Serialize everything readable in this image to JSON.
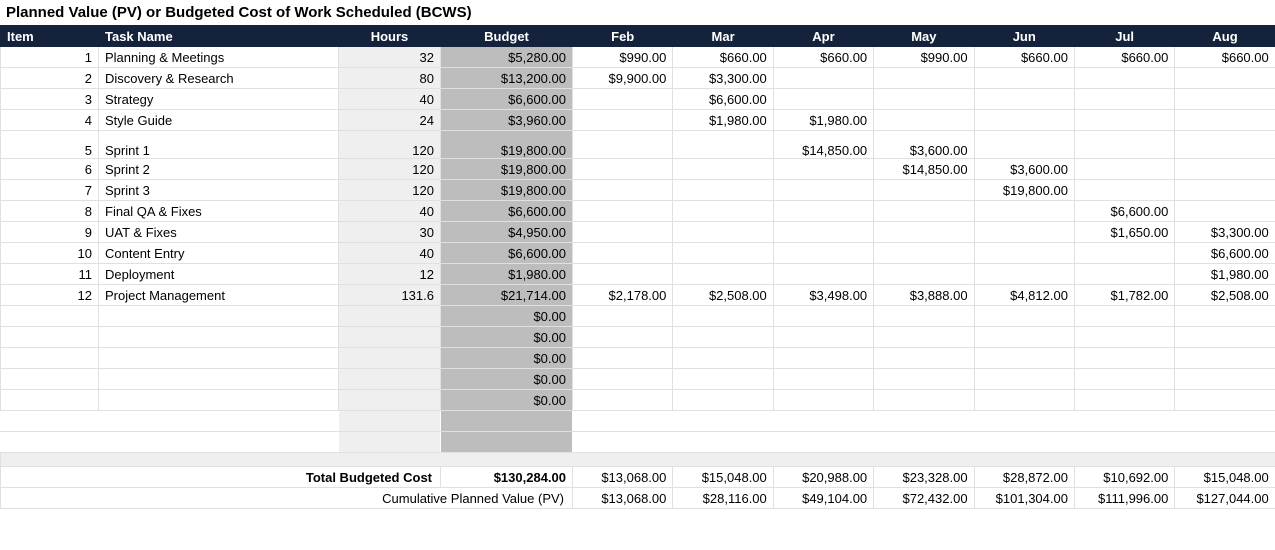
{
  "title": "Planned Value (PV) or Budgeted Cost of Work Scheduled (BCWS)",
  "headers": {
    "item": "Item",
    "task": "Task Name",
    "hours": "Hours",
    "budget": "Budget",
    "months": [
      "Feb",
      "Mar",
      "Apr",
      "May",
      "Jun",
      "Jul",
      "Aug"
    ]
  },
  "rows": [
    {
      "item": "1",
      "task": "Planning & Meetings",
      "hours": "32",
      "budget": "$5,280.00",
      "m": [
        "$990.00",
        "$660.00",
        "$660.00",
        "$990.00",
        "$660.00",
        "$660.00",
        "$660.00"
      ]
    },
    {
      "item": "2",
      "task": "Discovery & Research",
      "hours": "80",
      "budget": "$13,200.00",
      "m": [
        "$9,900.00",
        "$3,300.00",
        "",
        "",
        "",
        "",
        ""
      ]
    },
    {
      "item": "3",
      "task": "Strategy",
      "hours": "40",
      "budget": "$6,600.00",
      "m": [
        "",
        "$6,600.00",
        "",
        "",
        "",
        "",
        ""
      ]
    },
    {
      "item": "4",
      "task": "Style Guide",
      "hours": "24",
      "budget": "$3,960.00",
      "m": [
        "",
        "$1,980.00",
        "$1,980.00",
        "",
        "",
        "",
        ""
      ]
    },
    {
      "item": "5",
      "task": "Sprint 1",
      "hours": "120",
      "budget": "$19,800.00",
      "m": [
        "",
        "",
        "$14,850.00",
        "$3,600.00",
        "",
        "",
        ""
      ],
      "extraTop": true
    },
    {
      "item": "6",
      "task": "Sprint 2",
      "hours": "120",
      "budget": "$19,800.00",
      "m": [
        "",
        "",
        "",
        "$14,850.00",
        "$3,600.00",
        "",
        ""
      ]
    },
    {
      "item": "7",
      "task": "Sprint 3",
      "hours": "120",
      "budget": "$19,800.00",
      "m": [
        "",
        "",
        "",
        "",
        "$19,800.00",
        "",
        ""
      ]
    },
    {
      "item": "8",
      "task": "Final QA & Fixes",
      "hours": "40",
      "budget": "$6,600.00",
      "m": [
        "",
        "",
        "",
        "",
        "",
        "$6,600.00",
        ""
      ]
    },
    {
      "item": "9",
      "task": "UAT & Fixes",
      "hours": "30",
      "budget": "$4,950.00",
      "m": [
        "",
        "",
        "",
        "",
        "",
        "$1,650.00",
        "$3,300.00"
      ]
    },
    {
      "item": "10",
      "task": "Content Entry",
      "hours": "40",
      "budget": "$6,600.00",
      "m": [
        "",
        "",
        "",
        "",
        "",
        "",
        "$6,600.00"
      ]
    },
    {
      "item": "11",
      "task": "Deployment",
      "hours": "12",
      "budget": "$1,980.00",
      "m": [
        "",
        "",
        "",
        "",
        "",
        "",
        "$1,980.00"
      ]
    },
    {
      "item": "12",
      "task": "Project Management",
      "hours": "131.6",
      "budget": "$21,714.00",
      "m": [
        "$2,178.00",
        "$2,508.00",
        "$3,498.00",
        "$3,888.00",
        "$4,812.00",
        "$1,782.00",
        "$2,508.00"
      ]
    }
  ],
  "zero_budget_rows": 5,
  "totals": {
    "label": "Total Budgeted Cost",
    "budget": "$130,284.00",
    "m": [
      "$13,068.00",
      "$15,048.00",
      "$20,988.00",
      "$23,328.00",
      "$28,872.00",
      "$10,692.00",
      "$15,048.00"
    ]
  },
  "cumulative": {
    "label": "Cumulative Planned Value (PV)",
    "m": [
      "$13,068.00",
      "$28,116.00",
      "$49,104.00",
      "$72,432.00",
      "$101,304.00",
      "$111,996.00",
      "$127,044.00"
    ]
  },
  "zero": "$0.00"
}
